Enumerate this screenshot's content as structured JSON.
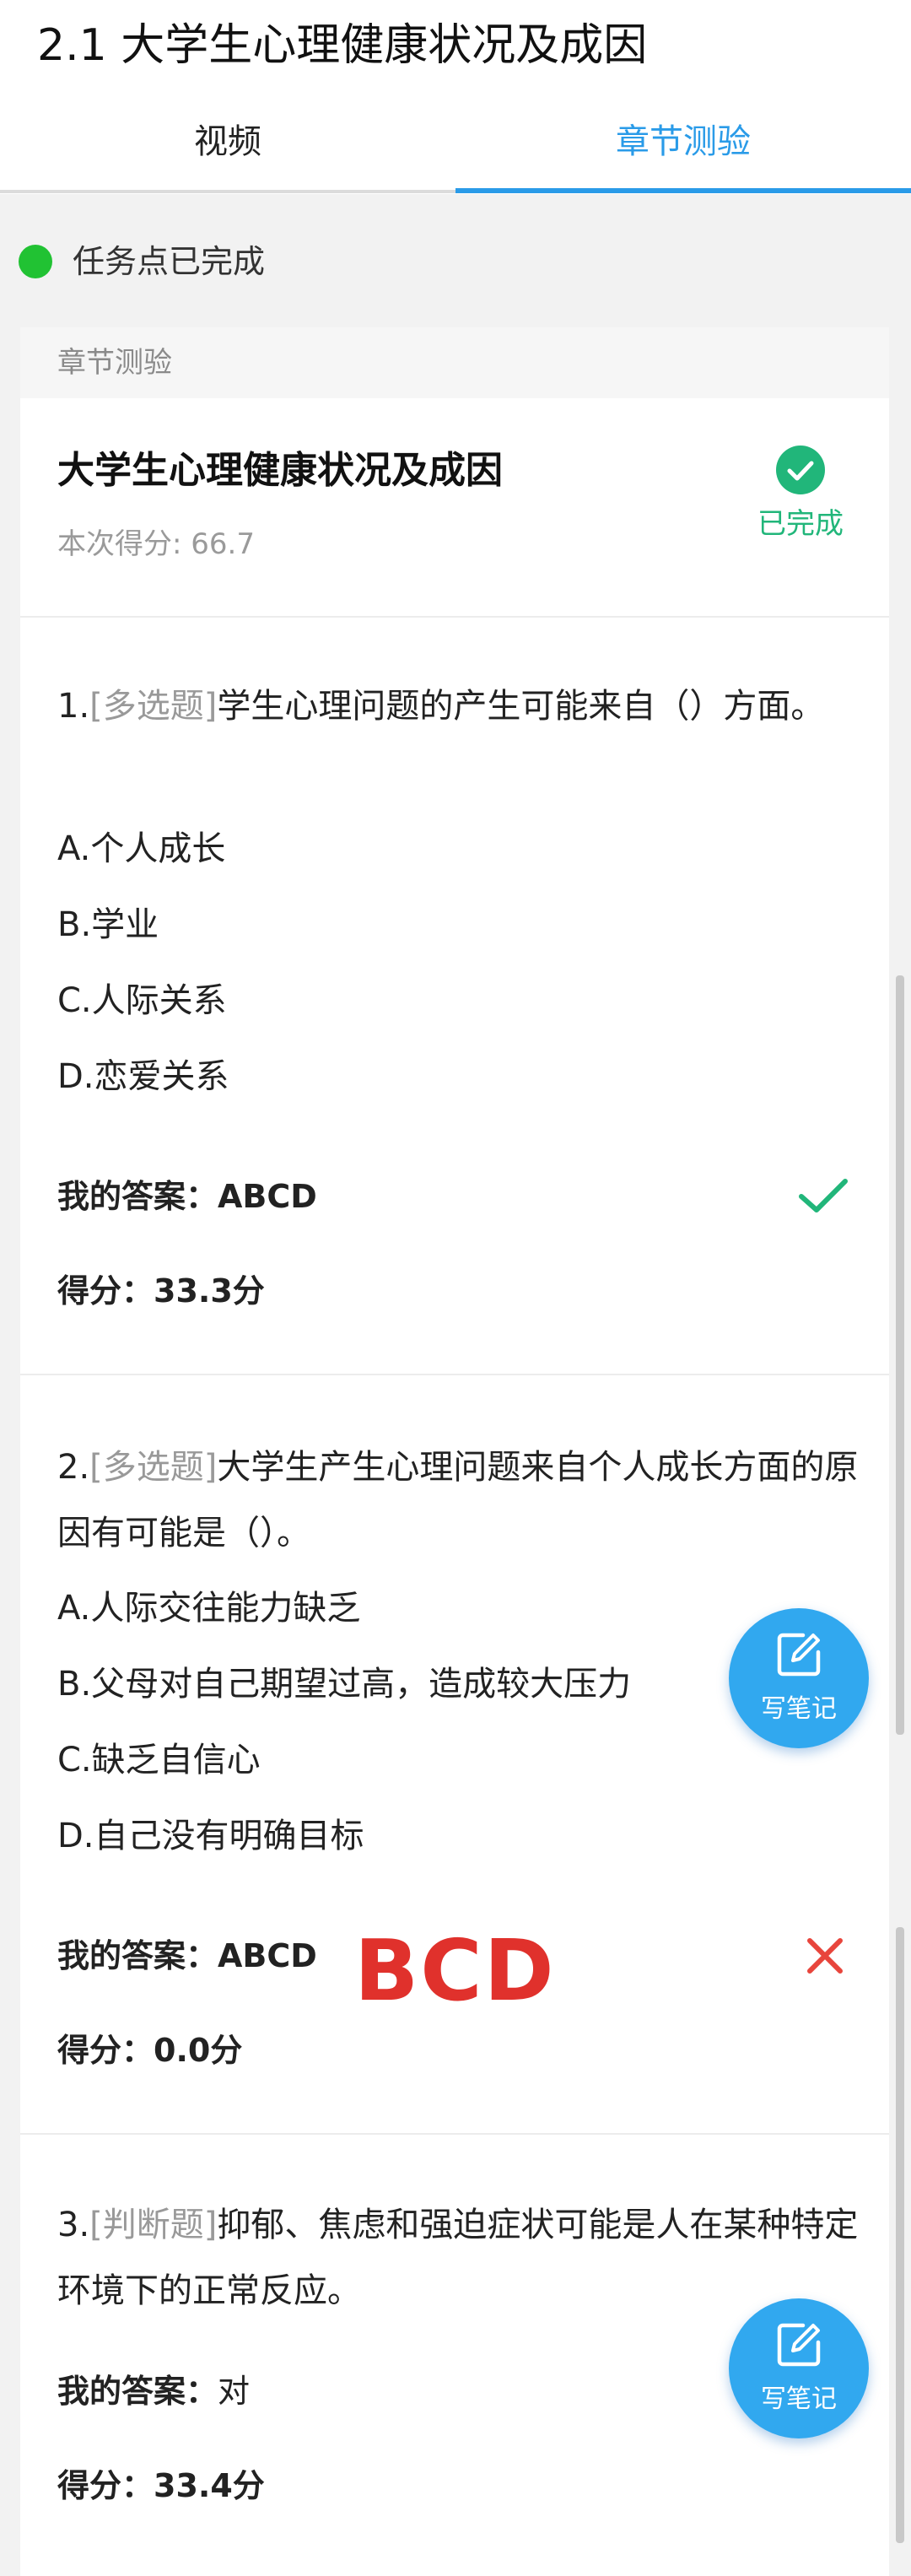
{
  "header": {
    "title": "2.1 大学生心理健康状况及成因",
    "tabs": [
      {
        "label": "视频",
        "active": false
      },
      {
        "label": "章节测验",
        "active": true
      }
    ]
  },
  "status": {
    "text": "任务点已完成",
    "color": "#21c233"
  },
  "card": {
    "header_label": "章节测验",
    "quiz_title": "大学生心理健康状况及成因",
    "score_text": "本次得分: 66.7",
    "done_label": "已完成"
  },
  "questions": [
    {
      "number": "1.",
      "type": "[多选题]",
      "text": "学生心理问题的产生可能来自（）方面。",
      "options": [
        "A.个人成长",
        "B.学业",
        "C.人际关系",
        "D.恋爱关系"
      ],
      "answer_label": "我的答案：",
      "answer_value": "ABCD",
      "score_label": "得分：",
      "score_value": "33.3分",
      "result": "correct"
    },
    {
      "number": "2.",
      "type": "[多选题]",
      "text": "大学生产生心理问题来自个人成长方面的原因有可能是（）。",
      "options": [
        "A.人际交往能力缺乏",
        "B.父母对自己期望过高，造成较大压力",
        "C.缺乏自信心",
        "D.自己没有明确目标"
      ],
      "answer_label": "我的答案：",
      "answer_value": "ABCD",
      "annotation": "BCD",
      "score_label": "得分：",
      "score_value": "0.0分",
      "result": "wrong"
    },
    {
      "number": "3.",
      "type": "[判断题]",
      "text": "抑郁、焦虑和强迫症状可能是人在某种特定环境下的正常反应。",
      "options": [],
      "answer_label": "我的答案：",
      "answer_value": "对",
      "score_label": "得分：",
      "score_value": "33.4分"
    }
  ],
  "fab": {
    "label": "写笔记",
    "color": "#31a8ef"
  },
  "colors": {
    "accent": "#2a9be8",
    "done_green": "#21b67a",
    "correct_green": "#21b67a",
    "wrong_red": "#e8453c",
    "annotation_red": "#e0312c"
  }
}
